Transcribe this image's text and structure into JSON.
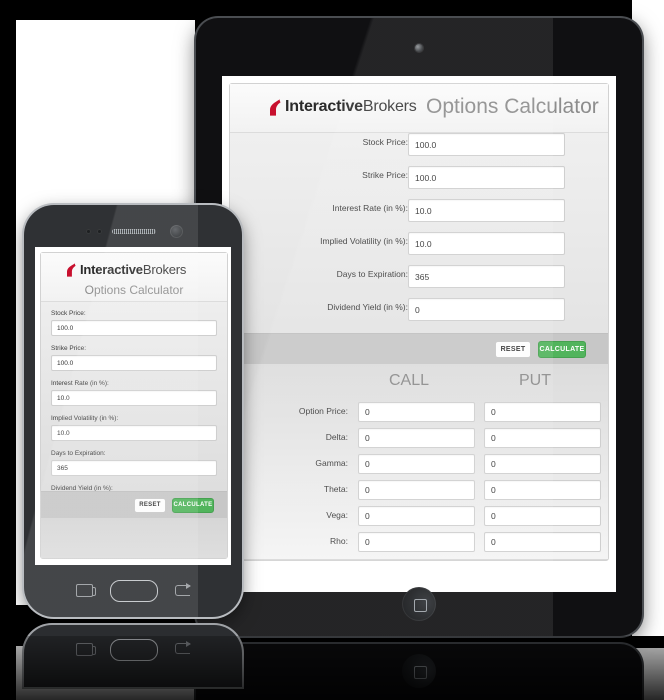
{
  "brand": {
    "logo_bold": "Interactive",
    "logo_light": "Brokers",
    "logo_color": "#c8102e"
  },
  "app": {
    "title": "Options Calculator"
  },
  "form": {
    "fields": [
      {
        "label": "Stock Price:",
        "value": "100.0"
      },
      {
        "label": "Strike Price:",
        "value": "100.0"
      },
      {
        "label": "Interest Rate (in %):",
        "value": "10.0"
      },
      {
        "label": "Implied Volatility (in %):",
        "value": "10.0"
      },
      {
        "label": "Days to Expiration:",
        "value": "365"
      },
      {
        "label": "Dividend Yield (in %):",
        "value": "0"
      }
    ]
  },
  "actions": {
    "reset_label": "RESET",
    "calculate_label": "CALCULATE",
    "calculate_color": "#51b45c"
  },
  "results": {
    "columns": [
      "CALL",
      "PUT"
    ],
    "rows": [
      {
        "label": "Option Price:",
        "call": "0",
        "put": "0"
      },
      {
        "label": "Delta:",
        "call": "0",
        "put": "0"
      },
      {
        "label": "Gamma:",
        "call": "0",
        "put": "0"
      },
      {
        "label": "Theta:",
        "call": "0",
        "put": "0"
      },
      {
        "label": "Vega:",
        "call": "0",
        "put": "0"
      },
      {
        "label": "Rho:",
        "call": "0",
        "put": "0"
      }
    ]
  },
  "devices": {
    "tablet": {
      "name": "tablet"
    },
    "phone": {
      "name": "phone"
    }
  }
}
